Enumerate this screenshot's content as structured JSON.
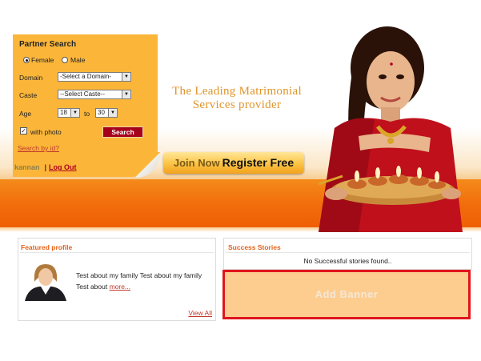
{
  "partner_search": {
    "title": "Partner Search",
    "gender_options": [
      "Female",
      "Male"
    ],
    "gender_selected": "Female",
    "domain_label": "Domain",
    "domain_value": "-Select a Domain-",
    "caste_label": "Caste",
    "caste_value": "--Select Caste--",
    "age_label": "Age",
    "age_from": "18",
    "age_to_label": "to",
    "age_to": "30",
    "with_photo_label": "with photo",
    "with_photo_checked": true,
    "search_button": "Search",
    "search_by_id_link": "Search by id?"
  },
  "user": {
    "username": "kannan",
    "separator": "|",
    "logout_link": "Log Out"
  },
  "hero": {
    "tagline_line1": "The Leading Matrimonial",
    "tagline_line2": "Services provider",
    "join_now": "Join Now",
    "register_free": "Register Free"
  },
  "featured_profile": {
    "heading": "Featured profile",
    "text": "Test about my family Test about my family Test about ",
    "more_link": "more...",
    "view_all_link": "View All"
  },
  "success_stories": {
    "heading": "Success Stories",
    "message": "No Successful stories found.."
  },
  "add_banner": {
    "label": "Add Banner"
  },
  "colors": {
    "panel_orange": "#fbb63a",
    "band_orange": "#f26c0c",
    "heading_orange": "#e4621a",
    "search_button_red": "#a5001c",
    "banner_border_red": "#e0141c",
    "banner_fill": "#fdcc8f"
  }
}
